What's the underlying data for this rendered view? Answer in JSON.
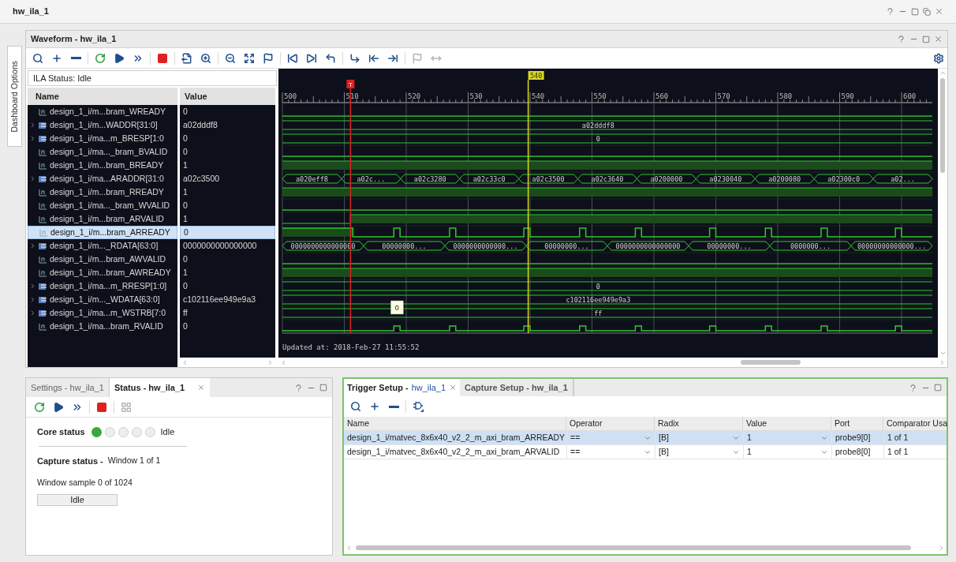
{
  "window": {
    "title": "hw_ila_1"
  },
  "side_tab": {
    "label": "Dashboard Options"
  },
  "waveform": {
    "title": "Waveform - hw_ila_1",
    "toolbar": [
      {
        "kind": "search",
        "disabled": false
      },
      {
        "kind": "add",
        "disabled": false
      },
      {
        "kind": "remove",
        "disabled": false
      },
      {
        "kind": "run-trigger",
        "disabled": false
      },
      {
        "kind": "play",
        "disabled": false
      },
      {
        "kind": "fast-forward",
        "disabled": false
      },
      {
        "kind": "stop",
        "disabled": false
      },
      {
        "kind": "export",
        "disabled": false
      },
      {
        "kind": "zoom-in",
        "disabled": false
      },
      {
        "kind": "zoom-out",
        "disabled": false
      },
      {
        "kind": "zoom-fit",
        "disabled": false
      },
      {
        "kind": "add-marker",
        "disabled": false
      },
      {
        "kind": "go-start",
        "disabled": false
      },
      {
        "kind": "go-end",
        "disabled": false
      },
      {
        "kind": "prev-edge",
        "disabled": false
      },
      {
        "kind": "next-edge",
        "disabled": false
      },
      {
        "kind": "prev-marker",
        "disabled": false
      },
      {
        "kind": "next-marker",
        "disabled": false
      },
      {
        "kind": "add-marker",
        "disabled": true
      },
      {
        "kind": "swap-markers",
        "disabled": true
      }
    ],
    "status": "ILA Status: Idle",
    "columns": [
      "Name",
      "Value"
    ],
    "signals": [
      {
        "kind": "bit",
        "name": "design_1_i/m...bram_WREADY",
        "value": "0",
        "high": false,
        "selected": false
      },
      {
        "kind": "bus",
        "name": "design_1_i/m...WADDR[31:0]",
        "value": "a02dddf8",
        "expanded": false,
        "selected": false,
        "segments": [
          "a02dddf8"
        ]
      },
      {
        "kind": "bus",
        "name": "design_1_i/ma...m_BRESP[1:0",
        "value": "0",
        "expanded": false,
        "selected": false,
        "segments": [
          "0"
        ]
      },
      {
        "kind": "bit",
        "name": "design_1_i/ma..._bram_BVALID",
        "value": "0",
        "high": false,
        "selected": false
      },
      {
        "kind": "bit",
        "name": "design_1_i/m...bram_BREADY",
        "value": "1",
        "high": true,
        "selected": false
      },
      {
        "kind": "bus",
        "name": "design_1_i/ma...ARADDR[31:0",
        "value": "a02c3500",
        "expanded": false,
        "selected": false,
        "segments": [
          "a020eff8",
          "a02c...",
          "a02c3280",
          "a02c33c0",
          "a02c3500",
          "a02c3640",
          "a0200000",
          "a0230040",
          "a0200080",
          "a02300c0",
          "a02..."
        ]
      },
      {
        "kind": "bit",
        "name": "design_1_i/m...bram_RREADY",
        "value": "1",
        "high": true,
        "selected": false
      },
      {
        "kind": "bit",
        "name": "design_1_i/ma..._bram_WVALID",
        "value": "0",
        "high": false,
        "selected": false
      },
      {
        "kind": "rise",
        "name": "design_1_i/m...bram_ARVALID",
        "value": "1",
        "selected": false
      },
      {
        "kind": "pulse",
        "name": "design_1_i/m...bram_ARREADY",
        "value": "0",
        "selected": true
      },
      {
        "kind": "bus",
        "name": "design_1_i/m..._RDATA[63:0]",
        "value": "0000000000000000",
        "expanded": false,
        "selected": false,
        "segments": [
          "0000000000000000",
          "00000000...",
          "0000000000000...",
          "00000000...",
          "0000000000000000",
          "00000000...",
          "0000000...",
          "00000000000000..."
        ]
      },
      {
        "kind": "bit",
        "name": "design_1_i/m...bram_AWVALID",
        "value": "0",
        "high": false,
        "selected": false
      },
      {
        "kind": "bit",
        "name": "design_1_i/m...bram_AWREADY",
        "value": "1",
        "high": true,
        "selected": false
      },
      {
        "kind": "bus",
        "name": "design_1_i/ma...m_RRESP[1:0]",
        "value": "0",
        "expanded": false,
        "selected": false,
        "segments": [
          "0"
        ]
      },
      {
        "kind": "bus",
        "name": "design_1_i/m..._WDATA[63:0]",
        "value": "c102116ee949e9a3",
        "expanded": false,
        "selected": false,
        "segments": [
          "c102116ee949e9a3"
        ]
      },
      {
        "kind": "bus",
        "name": "design_1_i/ma...m_WSTRB[7:0",
        "value": "ff",
        "expanded": false,
        "selected": false,
        "segments": [
          "ff"
        ]
      },
      {
        "kind": "blip",
        "name": "design_1_i/ma...bram_RVALID",
        "value": "0",
        "selected": false
      }
    ],
    "ruler": [
      "500",
      "510",
      "520",
      "530",
      "540",
      "550",
      "560",
      "570",
      "580",
      "590",
      "600"
    ],
    "cursor": "540",
    "trigger": "T",
    "tooltip": "0",
    "updated": "Updated at: 2018-Feb-27 11:55:52"
  },
  "status_panel": {
    "tabs": [
      {
        "label": "Settings - hw_ila_1",
        "selected": false
      },
      {
        "label": "Status - hw_ila_1",
        "selected": true
      }
    ],
    "toolbar": [
      {
        "kind": "run-trigger",
        "disabled": false
      },
      {
        "kind": "play",
        "disabled": false
      },
      {
        "kind": "fast-forward",
        "disabled": false
      },
      {
        "kind": "stop",
        "disabled": false
      },
      {
        "kind": "layout",
        "disabled": true
      }
    ],
    "core_label": "Core status",
    "dots": [
      {
        "on": true
      },
      {
        "on": false
      },
      {
        "on": false
      },
      {
        "on": false
      },
      {
        "on": false
      }
    ],
    "core_state": "Idle",
    "capture_label": "Capture status -",
    "capture_value": "Window 1 of 1",
    "sample": "Window sample 0 of 1024",
    "progress": "Idle"
  },
  "trigger_panel": {
    "active": true,
    "tabs": [
      {
        "label": "Trigger Setup -",
        "sub": "hw_ila_1",
        "selected": true
      },
      {
        "label": "Capture Setup - hw_ila_1",
        "selected": false
      }
    ],
    "toolbar": [
      {
        "kind": "search",
        "disabled": false
      },
      {
        "kind": "add",
        "disabled": false
      },
      {
        "kind": "remove",
        "disabled": false
      },
      {
        "kind": "gate",
        "disabled": false
      }
    ],
    "columns": [
      "Name",
      "Operator",
      "Radix",
      "Value",
      "Port",
      "Comparator Usa"
    ],
    "rows": [
      {
        "name": "design_1_i/matvec_8x6x40_v2_2_m_axi_bram_ARREADY",
        "operator": "==",
        "radix": "[B]",
        "value": "1",
        "port": "probe9[0]",
        "usage": "1 of 1",
        "selected": true
      },
      {
        "name": "design_1_i/matvec_8x6x40_v2_2_m_axi_bram_ARVALID",
        "operator": "==",
        "radix": "[B]",
        "value": "1",
        "port": "probe8[0]",
        "usage": "1 of 1",
        "selected": false
      }
    ]
  }
}
